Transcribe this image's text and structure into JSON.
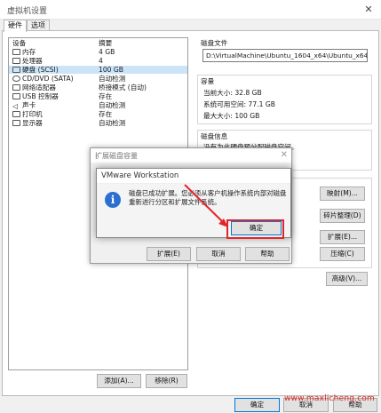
{
  "window": {
    "title": "虚拟机设置",
    "close": "✕"
  },
  "tabs": [
    {
      "label": "硬件"
    },
    {
      "label": "选项"
    }
  ],
  "device_list": {
    "headers": {
      "device": "设备",
      "summary": "摘要"
    },
    "items": [
      {
        "name": "内存",
        "summary": "4 GB",
        "icon": "memory-icon"
      },
      {
        "name": "处理器",
        "summary": "4",
        "icon": "cpu-icon"
      },
      {
        "name": "硬盘 (SCSI)",
        "summary": "100 GB",
        "icon": "harddisk-icon",
        "selected": true
      },
      {
        "name": "CD/DVD (SATA)",
        "summary": "自动检测",
        "icon": "cdrom-icon"
      },
      {
        "name": "网络适配器",
        "summary": "桥接模式 (自动)",
        "icon": "network-icon"
      },
      {
        "name": "USB 控制器",
        "summary": "存在",
        "icon": "usb-icon"
      },
      {
        "name": "声卡",
        "summary": "自动检测",
        "icon": "sound-icon"
      },
      {
        "name": "打印机",
        "summary": "存在",
        "icon": "printer-icon"
      },
      {
        "name": "显示器",
        "summary": "自动检测",
        "icon": "display-icon"
      }
    ],
    "add_button": "添加(A)...",
    "remove_button": "移除(R)"
  },
  "disk_file": {
    "label": "磁盘文件",
    "value": "D:\\VirtualMachine\\Ubuntu_1604_x64\\Ubuntu_x64_160"
  },
  "capacity": {
    "label": "容量",
    "current_size": "当前大小: 32.8 GB",
    "free_space": "系统可用空间: 77.1 GB",
    "max_size": "最大大小: 100 GB"
  },
  "disk_info": {
    "label": "磁盘信息",
    "text": "没有为此硬盘预分配磁盘空间。"
  },
  "utility_buttons": {
    "map": "映射(M)...",
    "defrag": "碎片整理(D)",
    "expand": "扩展(E)...",
    "compact": "压缩(C)",
    "advanced": "高级(V)..."
  },
  "expand_dialog": {
    "title": "扩展磁盘容量",
    "expand_button": "扩展(E)",
    "cancel_button": "取消",
    "help_button": "帮助"
  },
  "message_dialog": {
    "title": "VMware Workstation",
    "message": "磁盘已成功扩展。您必须从客户机操作系统内部对磁盘重新进行分区和扩展文件系统。",
    "ok_button": "确定"
  },
  "footer": {
    "ok": "确定",
    "cancel": "取消",
    "help": "帮助"
  },
  "watermark": "www.maxlicheng.com"
}
